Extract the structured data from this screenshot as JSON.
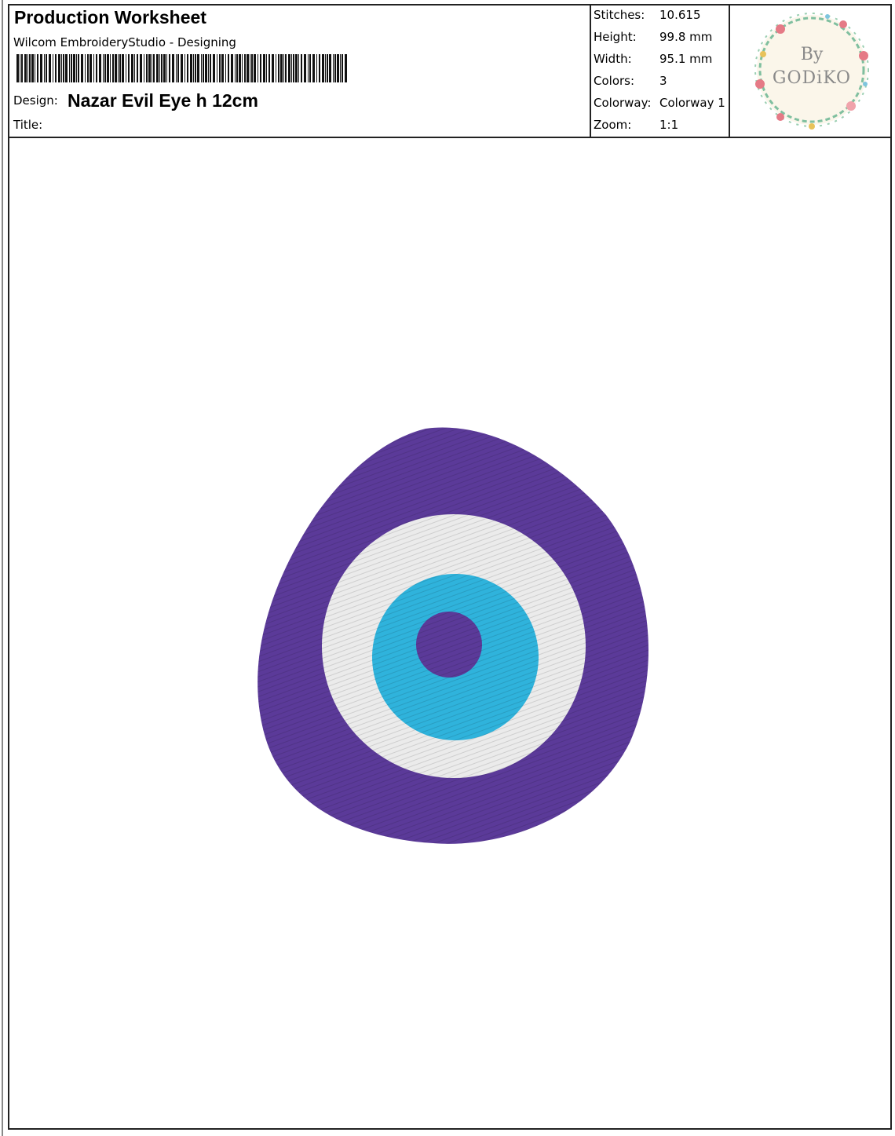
{
  "header": {
    "title": "Production Worksheet",
    "software": "Wilcom EmbroideryStudio - Designing",
    "design_label": "Design:",
    "design_name": "Nazar Evil Eye h 12cm",
    "title_label": "Title:"
  },
  "info": [
    {
      "key": "Stitches:",
      "value": "10.615"
    },
    {
      "key": "Height:",
      "value": "99.8 mm"
    },
    {
      "key": "Width:",
      "value": "95.1 mm"
    },
    {
      "key": "Colors:",
      "value": "3"
    },
    {
      "key": "Colorway:",
      "value": "Colorway 1"
    },
    {
      "key": "Zoom:",
      "value": "1:1"
    }
  ],
  "logo": {
    "line1": "By",
    "line2": "GODiKO",
    "icon": "floral-wreath-logo"
  },
  "design_colors": {
    "outer": "#5b3a99",
    "white": "#ebebeb",
    "iris": "#2fb3dc",
    "pupil": "#5b3a99"
  }
}
